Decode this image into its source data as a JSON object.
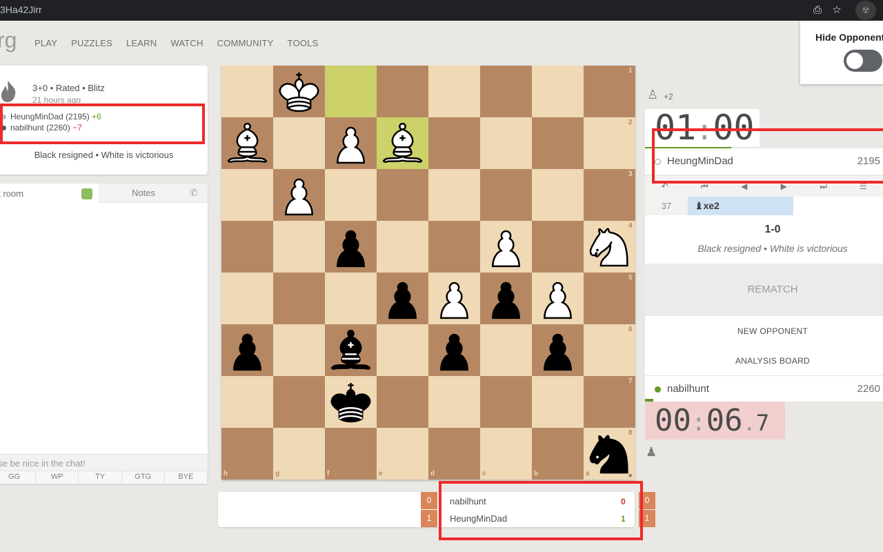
{
  "browser": {
    "url_fragment": "3Ha42Jirr",
    "icons": [
      "install-icon",
      "star-icon",
      "extension-icon"
    ]
  },
  "site": {
    "logo_fragment": "rg",
    "nav": [
      "PLAY",
      "PUZZLES",
      "LEARN",
      "WATCH",
      "COMMUNITY",
      "TOOLS"
    ]
  },
  "game_info": {
    "type": "3+0 • Rated • Blitz",
    "time_ago": "21 hours ago",
    "white": {
      "name": "HeungMinDad (2195)",
      "diff": "+6"
    },
    "black": {
      "name": "nabilhunt (2260)",
      "diff": "−7"
    },
    "result": "Black resigned • White is victorious"
  },
  "chat": {
    "tab_chat": "at room",
    "tab_notes": "Notes",
    "input_placeholder": "ase be nice in the chat!",
    "quick": [
      "GG",
      "WP",
      "TY",
      "GTG",
      "BYE"
    ]
  },
  "board": {
    "orientation": "black",
    "ranks": [
      "1",
      "2",
      "3",
      "4",
      "5",
      "6",
      "7",
      "8"
    ],
    "files": [
      "h",
      "g",
      "f",
      "e",
      "d",
      "c",
      "b",
      "a"
    ],
    "highlights": [
      "f1",
      "e2"
    ],
    "pieces": [
      {
        "sq": "g1",
        "piece": "wK"
      },
      {
        "sq": "h2",
        "piece": "wB"
      },
      {
        "sq": "f2",
        "piece": "wP"
      },
      {
        "sq": "e2",
        "piece": "wB"
      },
      {
        "sq": "g3",
        "piece": "wP"
      },
      {
        "sq": "f4",
        "piece": "bP"
      },
      {
        "sq": "c4",
        "piece": "wP"
      },
      {
        "sq": "a4",
        "piece": "wN"
      },
      {
        "sq": "e5",
        "piece": "bP"
      },
      {
        "sq": "d5",
        "piece": "wP"
      },
      {
        "sq": "c5",
        "piece": "bP"
      },
      {
        "sq": "b5",
        "piece": "wP"
      },
      {
        "sq": "h6",
        "piece": "bP"
      },
      {
        "sq": "f6",
        "piece": "bB"
      },
      {
        "sq": "d6",
        "piece": "bP"
      },
      {
        "sq": "b6",
        "piece": "bP"
      },
      {
        "sq": "f7",
        "piece": "bK"
      },
      {
        "sq": "a8",
        "piece": "bN"
      }
    ]
  },
  "score_table": {
    "rows": [
      {
        "num": "0",
        "name": "nabilhunt",
        "score": "0",
        "color": "#cc3333"
      },
      {
        "num": "1",
        "name": "HeungMinDad",
        "score": "1",
        "color": "#629924"
      }
    ]
  },
  "right_panel": {
    "material_top": "+2",
    "clock_top": {
      "mm": "01",
      "ss": "00"
    },
    "top_player": {
      "name": "HeungMinDad",
      "rating": "2195"
    },
    "controls": [
      "first-move-icon",
      "prev-icon",
      "back-icon",
      "forward-icon",
      "last-move-icon",
      "menu-icon"
    ],
    "move_number": "37",
    "move_san": "xe2",
    "result_score": "1-0",
    "result_text": "Black resigned • White is victorious",
    "rematch": "REMATCH",
    "new_opponent": "NEW OPPONENT",
    "analysis_board": "ANALYSIS BOARD",
    "bottom_player": {
      "name": "nabilhunt",
      "rating": "2260"
    },
    "clock_bottom": {
      "mm": "00",
      "ss": "06",
      "tenths": "7"
    }
  },
  "popup": {
    "title": "Hide Opponent",
    "toggle_on": false
  },
  "colors": {
    "light_square": "#f0d9b5",
    "dark_square": "#b58863",
    "highlight": "#cdd16a",
    "win_green": "#629924",
    "loss_red": "#cc3333",
    "annotation_red": "#ef2a2a"
  }
}
